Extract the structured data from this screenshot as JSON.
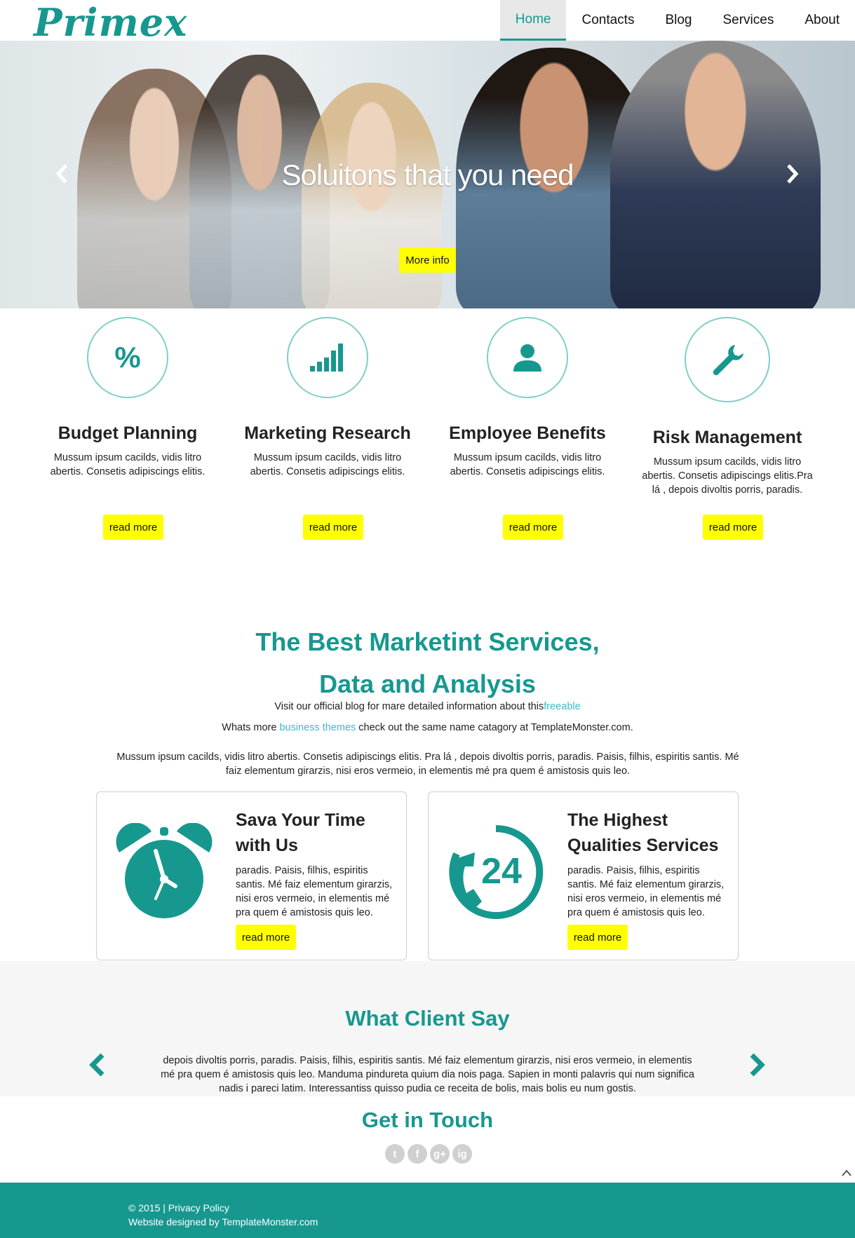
{
  "brand": {
    "logo": "Primex",
    "accent": "#17988f",
    "button_color": "#ffff00",
    "footer_bg": "#17988f"
  },
  "nav": {
    "items": [
      "Home",
      "Contacts",
      "Blog",
      "Services",
      "About"
    ],
    "active": "Home"
  },
  "hero": {
    "title": "Soluitons that you need",
    "button": "More info",
    "prev_icon": "chevron-left-icon",
    "next_icon": "chevron-right-icon"
  },
  "features": [
    {
      "icon": "percent-icon",
      "title": "Budget Planning",
      "text": "Mussum ipsum cacilds, vidis litro abertis. Consetis adipiscings elitis.",
      "button": "read more"
    },
    {
      "icon": "signal-bars-icon",
      "title": "Marketing Research",
      "text": "Mussum ipsum cacilds, vidis litro abertis. Consetis adipiscings elitis.",
      "button": "read more"
    },
    {
      "icon": "user-icon",
      "title": "Employee Benefits",
      "text": "Mussum ipsum cacilds, vidis litro abertis. Consetis adipiscings elitis.",
      "button": "read more"
    },
    {
      "icon": "wrench-icon",
      "title": "Risk Management",
      "text": "Mussum ipsum cacilds, vidis litro abertis. Consetis adipiscings elitis.Pra lá , depois divoltis porris, paradis.",
      "button": "read more"
    }
  ],
  "marketing": {
    "title_line1": "The Best Marketint Services,",
    "title_line2": "Data and Analysis",
    "line1_prefix": "Visit our official blog for mare detailed information about this",
    "line1_link": "freeable",
    "line2_prefix": "Whats more ",
    "line2_link": "business themes",
    "line2_suffix": " check out the same name catagory at TemplateMonster.com.",
    "paragraph": "Mussum ipsum cacilds, vidis litro abertis. Consetis adipiscings elitis. Pra lá , depois divoltis porris, paradis. Paisis, filhis, espiritis santis. Mé faiz elementum girarzis, nisi eros vermeio, in elementis mé pra quem é amistosis quis leo."
  },
  "cards": [
    {
      "icon": "alarm-clock-icon",
      "title": "Sava Your Time with Us",
      "text": "paradis. Paisis, filhis, espiritis santis. Mé faiz elementum girarzis, nisi eros vermeio, in elementis mé pra quem é amistosis quis leo.",
      "button": "read more"
    },
    {
      "icon": "support-24-icon",
      "icon_label": "24",
      "title": "The Highest Qualities Services",
      "text": "paradis. Paisis, filhis, espiritis santis. Mé faiz elementum girarzis, nisi eros vermeio, in elementis mé pra quem é amistosis quis leo.",
      "button": "read more"
    }
  ],
  "clients": {
    "title": "What Client Say",
    "quote": "depois divoltis porris, paradis. Paisis, filhis, espiritis santis. Mé faiz elementum girarzis, nisi eros vermeio, in elementis mé pra quem é amistosis quis leo. Manduma pindureta quium dia nois paga. Sapien in monti palavris qui num significa nadis i pareci latim. Interessantiss quisso pudia ce receita de bolis, mais bolis eu num gostis."
  },
  "touch": {
    "title": "Get in Touch",
    "social": [
      "twitter-icon",
      "facebook-icon",
      "google-plus-icon",
      "instagram-icon"
    ],
    "social_glyphs": [
      "t",
      "f",
      "g+",
      "ig"
    ]
  },
  "footer": {
    "copyright": "© 2015 | ",
    "privacy": "Privacy Policy",
    "designed_prefix": "Website designed by ",
    "designed_link": "TemplateMonster.com"
  }
}
